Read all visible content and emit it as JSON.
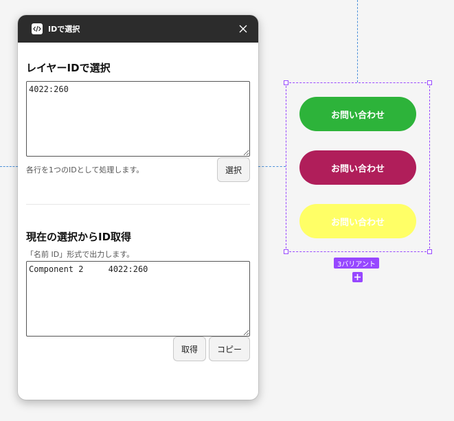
{
  "panel": {
    "title": "IDで選択",
    "section1": {
      "title": "レイヤーIDで選択",
      "textarea_value": "4022:260",
      "hint": "各行を1つのIDとして処理します。",
      "select_button": "選択"
    },
    "section2": {
      "title": "現在の選択からID取得",
      "hint": "「名前 ID」形式で出力します。",
      "textarea_value": "Component 2     4022:260",
      "get_button": "取得",
      "copy_button": "コピー"
    }
  },
  "canvas": {
    "variants": [
      {
        "label": "お問い合わせ",
        "color": "#2db33a"
      },
      {
        "label": "お問い合わせ",
        "color": "#b01e5a"
      },
      {
        "label": "お問い合わせ",
        "color": "#ffff66"
      }
    ],
    "variant_badge": "3バリアント"
  },
  "colors": {
    "selection": "#9747ff",
    "guide": "#4a90d9",
    "titlebar": "#2c2c2c"
  }
}
